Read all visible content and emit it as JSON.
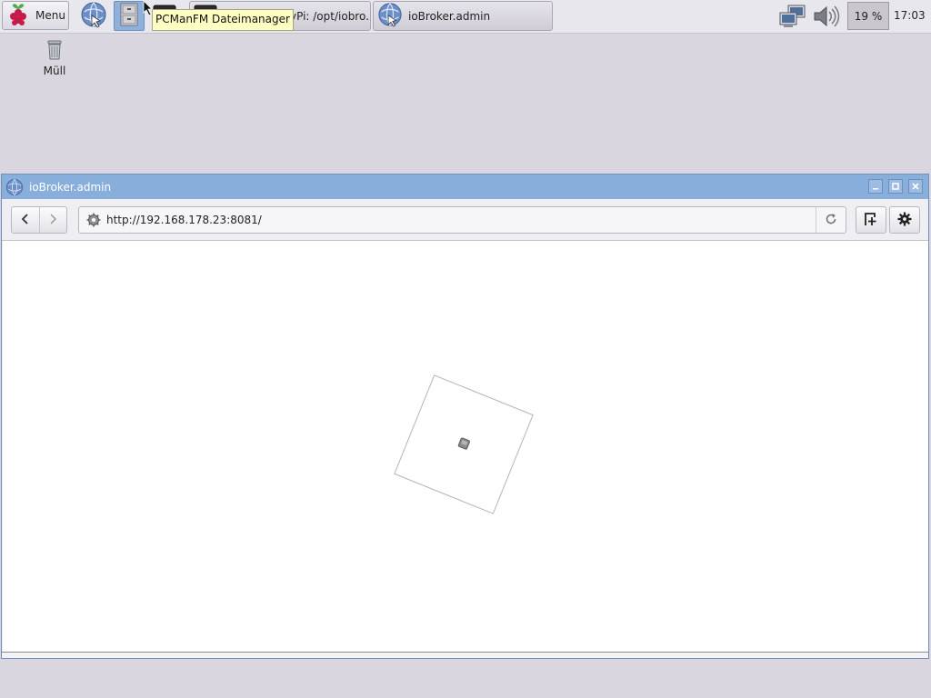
{
  "panel": {
    "menu_label": "Menu",
    "tooltip": "PCManFM Dateimanager",
    "tasks": [
      {
        "label": "yPi: /opt/iobro..."
      },
      {
        "label": "ioBroker.admin"
      }
    ],
    "cpu": "19 %",
    "clock": "17:03"
  },
  "desktop": {
    "trash_label": "Müll"
  },
  "window": {
    "title": "ioBroker.admin",
    "url": "http://192.168.178.23:8081/"
  },
  "icons": {
    "menu": "raspberry-icon",
    "browser": "globe-icon",
    "filemanager": "file-cabinet-icon",
    "terminal": "terminal-icon",
    "network": "network-icon",
    "volume": "speaker-icon",
    "trash": "trash-can-icon",
    "site": "gear-icon",
    "reload": "reload-icon",
    "newtab": "new-tab-icon",
    "settings": "settings-icon"
  },
  "colors": {
    "titlebar": "#88aedb",
    "desktop": "#d9d6e0",
    "tooltip": "#ffffc4"
  }
}
